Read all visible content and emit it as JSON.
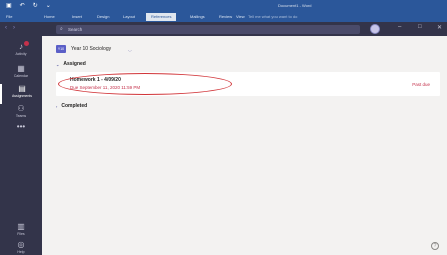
{
  "word": {
    "qat_icons": [
      "save-icon",
      "undo-icon",
      "redo-icon",
      "more-icon"
    ],
    "title": "Document1 - Word",
    "tabs": [
      {
        "label": "File",
        "active": false
      },
      {
        "label": "Home",
        "active": false
      },
      {
        "label": "Insert",
        "active": false
      },
      {
        "label": "Design",
        "active": false
      },
      {
        "label": "Layout",
        "active": false
      },
      {
        "label": "References",
        "active": true
      },
      {
        "label": "Mailings",
        "active": false
      },
      {
        "label": "Review",
        "active": false
      },
      {
        "label": "View",
        "active": false
      }
    ],
    "tell_me": "Tell me what you want to do"
  },
  "teams": {
    "search_placeholder": "Search",
    "rail": [
      {
        "label": "Activity",
        "icon": "bell-icon"
      },
      {
        "label": "Calendar",
        "icon": "calendar-icon"
      },
      {
        "label": "Assignments",
        "icon": "assignments-icon",
        "active": true
      },
      {
        "label": "Teams",
        "icon": "teams-icon"
      },
      {
        "label": "",
        "icon": "more-icon"
      },
      {
        "label": "Files",
        "icon": "files-icon"
      },
      {
        "label": "Help",
        "icon": "help-icon"
      }
    ],
    "class": {
      "avatar_text": "Y10",
      "name": "Year 10 Sociology"
    },
    "assigned_label": "Assigned",
    "assignment": {
      "title": "Homework 1 - 4/09/20",
      "due": "Due September 11, 2020 11:59 PM",
      "status": "Past due"
    },
    "completed_label": "Completed",
    "colors": {
      "accent": "#6264a7",
      "word_blue": "#2b579a",
      "past_due": "#c4314b",
      "highlight": "#d13438"
    }
  }
}
